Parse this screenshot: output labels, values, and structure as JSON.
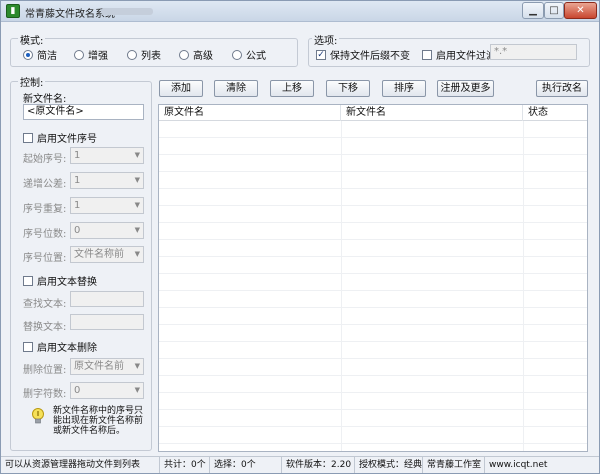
{
  "window": {
    "title": "常青藤文件改名系统"
  },
  "mode": {
    "label": "模式:",
    "options": [
      "简洁",
      "增强",
      "列表",
      "高级",
      "公式"
    ],
    "selected_index": 0
  },
  "options": {
    "label": "选项:",
    "keep_ext_label": "保持文件后缀不变",
    "keep_ext_checked": true,
    "filter_label": "启用文件过滤",
    "filter_checked": false,
    "filter_value": "*.*"
  },
  "control": {
    "label": "控制:",
    "new_name_label": "新文件名:",
    "new_name_value": "<原文件名>",
    "seq": {
      "enable_label": "启用文件序号",
      "enabled": false,
      "start_label": "起始序号:",
      "start_value": "1",
      "step_label": "递增公差:",
      "step_value": "1",
      "repeat_label": "序号重复:",
      "repeat_value": "1",
      "digits_label": "序号位数:",
      "digits_value": "0",
      "pos_label": "序号位置:",
      "pos_value": "文件名称前"
    },
    "replace": {
      "enable_label": "启用文本替换",
      "enabled": false,
      "find_label": "查找文本:",
      "replace_label": "替换文本:"
    },
    "delete": {
      "enable_label": "启用文本删除",
      "enabled": false,
      "pos_label": "删除位置:",
      "pos_value": "原文件名前",
      "count_label": "删字符数:",
      "count_value": "0"
    },
    "hint": "新文件名称中的序号只能出现在新文件名称前或新文件名称后。"
  },
  "toolbar": {
    "add": "添加",
    "clear": "清除",
    "up": "上移",
    "down": "下移",
    "sort": "排序",
    "register": "注册及更多",
    "execute": "执行改名"
  },
  "list": {
    "columns": [
      "原文件名",
      "新文件名",
      "状态"
    ]
  },
  "statusbar": {
    "drag_hint": "可以从资源管理器拖动文件到列表",
    "total": "共计：0个",
    "selected": "选择：0个",
    "version": "软件版本：2.20",
    "license": "授权模式：经典",
    "studio": "常青藤工作室",
    "url": "www.icqt.net"
  }
}
